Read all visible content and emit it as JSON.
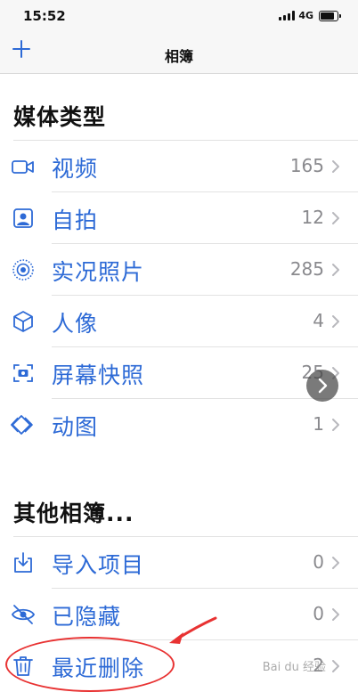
{
  "status_bar": {
    "time": "15:52",
    "network": "4G"
  },
  "navbar": {
    "title": "相簿"
  },
  "sections": [
    {
      "title": "媒体类型",
      "items": [
        {
          "label": "视频",
          "count": "165",
          "icon": "video-icon"
        },
        {
          "label": "自拍",
          "count": "12",
          "icon": "selfie-portrait-icon"
        },
        {
          "label": "实况照片",
          "count": "285",
          "icon": "live-photo-icon"
        },
        {
          "label": "人像",
          "count": "4",
          "icon": "portrait-cube-icon"
        },
        {
          "label": "屏幕快照",
          "count": "25",
          "icon": "screenshot-icon"
        },
        {
          "label": "动图",
          "count": "1",
          "icon": "animated-icon"
        }
      ]
    },
    {
      "title": "其他相簿...",
      "items": [
        {
          "label": "导入项目",
          "count": "0",
          "icon": "import-icon"
        },
        {
          "label": "已隐藏",
          "count": "0",
          "icon": "hidden-eye-icon"
        },
        {
          "label": "最近删除",
          "count": "2",
          "icon": "trash-icon"
        }
      ]
    }
  ],
  "watermark": "Bai du 经验",
  "colors": {
    "accent": "#2d6ad6",
    "annotation": "#e83232"
  }
}
